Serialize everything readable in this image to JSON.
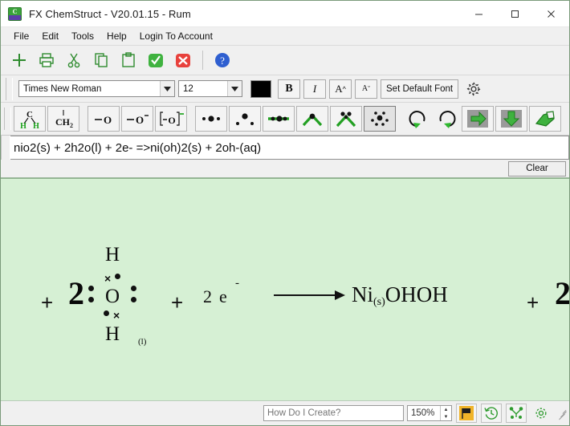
{
  "window": {
    "title": "FX ChemStruct - V20.01.15 - Rum",
    "app_icon": "chemstruct-app-icon",
    "minimize": "minimize-icon",
    "maximize": "maximize-icon",
    "close": "close-icon"
  },
  "menu": {
    "items": [
      {
        "label": "File"
      },
      {
        "label": "Edit"
      },
      {
        "label": "Tools"
      },
      {
        "label": "Help"
      },
      {
        "label": "Login To Account"
      }
    ]
  },
  "toolbar_main": {
    "buttons": [
      {
        "name": "new-icon",
        "title": "New"
      },
      {
        "name": "print-icon",
        "title": "Print"
      },
      {
        "name": "cut-icon",
        "title": "Cut"
      },
      {
        "name": "copy-icon",
        "title": "Copy"
      },
      {
        "name": "paste-icon",
        "title": "Paste"
      },
      {
        "name": "accept-check-icon",
        "title": "Accept"
      },
      {
        "name": "cancel-x-icon",
        "title": "Cancel"
      },
      {
        "name": "help-question-icon",
        "title": "Help"
      }
    ]
  },
  "toolbar_font": {
    "font_family_value": "Times New Roman",
    "font_size_value": "12",
    "color_swatch": "#000000",
    "bold_label": "B",
    "italic_label": "I",
    "increase_size_label": "A",
    "decrease_size_label": "A",
    "set_default_font_label": "Set Default Font",
    "settings_icon": "gear-icon"
  },
  "toolbar_chem": {
    "buttons": [
      {
        "name": "methane-ch-structure-icon",
        "label": "C / H H"
      },
      {
        "name": "ch2-group-icon",
        "label": "CH2"
      },
      {
        "name": "single-bond-oxygen-icon",
        "label": "-O"
      },
      {
        "name": "oxygen-anion-icon",
        "label": "-O-"
      },
      {
        "name": "bracketed-oxygen-anion-icon",
        "label": "[-O]-"
      },
      {
        "name": "three-dot-lone-pair-icon",
        "label": "dots-row"
      },
      {
        "name": "triangle-dots-icon",
        "label": "dots-triangle"
      },
      {
        "name": "bonded-pair-icon",
        "label": "bond-dots"
      },
      {
        "name": "bent-bond-icon",
        "label": "bent"
      },
      {
        "name": "bent-bond-lone-pair-icon",
        "label": "bent-dots"
      },
      {
        "name": "electron-cloud-icon",
        "label": "cloud"
      },
      {
        "name": "undo-icon",
        "label": "Undo"
      },
      {
        "name": "redo-icon",
        "label": "Redo"
      },
      {
        "name": "export-right-icon",
        "label": "Export"
      },
      {
        "name": "download-down-icon",
        "label": "Save"
      },
      {
        "name": "eraser-icon",
        "label": "Erase"
      }
    ]
  },
  "formula": {
    "value": "nio2(s) + 2h2o(l) + 2e- =>ni(oh)2(s) + 2oh-(aq)",
    "placeholder": "",
    "clear_label": "Clear"
  },
  "canvas": {
    "background": "#d6f0d4",
    "equation": {
      "plus1": "+",
      "coefficient_water": "2",
      "water": {
        "top_hydrogen": "H",
        "bottom_hydrogen": "H",
        "central_atom": "O",
        "state_label": "(l)"
      },
      "plus2": "+",
      "electron_coefficient": "2",
      "electron_symbol": "e",
      "electron_charge": "-",
      "arrow": "reaction-arrow",
      "product": "Ni",
      "product_state": "(s)",
      "product_rest": "OHOH",
      "plus3": "+",
      "trailing_coefficient": "2"
    }
  },
  "statusbar": {
    "help_placeholder": "How Do I Create?",
    "help_value": "",
    "zoom_value": "150%",
    "buttons": [
      {
        "name": "flag-icon"
      },
      {
        "name": "history-clock-icon"
      },
      {
        "name": "molecule-icon"
      },
      {
        "name": "settings-gear-icon"
      }
    ]
  }
}
